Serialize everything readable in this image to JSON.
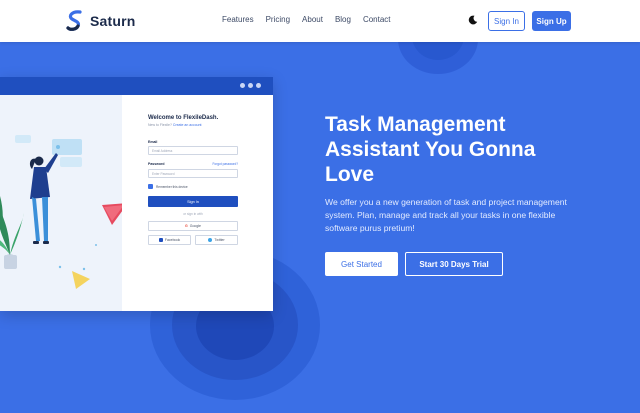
{
  "brand": {
    "name": "Saturn"
  },
  "nav": {
    "items": [
      "Features",
      "Pricing",
      "About",
      "Blog",
      "Contact"
    ]
  },
  "header": {
    "signin_label": "Sign In",
    "signup_label": "Sign Up"
  },
  "hero": {
    "title": "Task Management Assistant You Gonna Love",
    "description": "We offer you a new generation of task and project management system. Plan, manage and track all your tasks in one flexible software purus pretium!",
    "primary_button": "Get Started",
    "secondary_button": "Start 30 Days Trial"
  },
  "mockup": {
    "form_title": "Welcome to FlexileDash.",
    "form_subtitle": "New to Flexile?",
    "form_subtitle_link": "Create an account",
    "email_label": "Email",
    "email_placeholder": "Email Address",
    "password_label": "Password",
    "password_placeholder": "Enter Password",
    "forgot_label": "Forgot password?",
    "remember_label": "Remember this device",
    "signin_button": "Sign In",
    "or_text": "or sign in with",
    "google_label": "Google",
    "facebook_label": "Facebook",
    "twitter_label": "Twitter"
  },
  "colors": {
    "primary": "#3b6fe6",
    "dark_blue": "#1f4fbf",
    "white": "#ffffff"
  },
  "icons": {
    "theme_toggle": "moon-icon",
    "logo": "saturn-s-logo"
  }
}
